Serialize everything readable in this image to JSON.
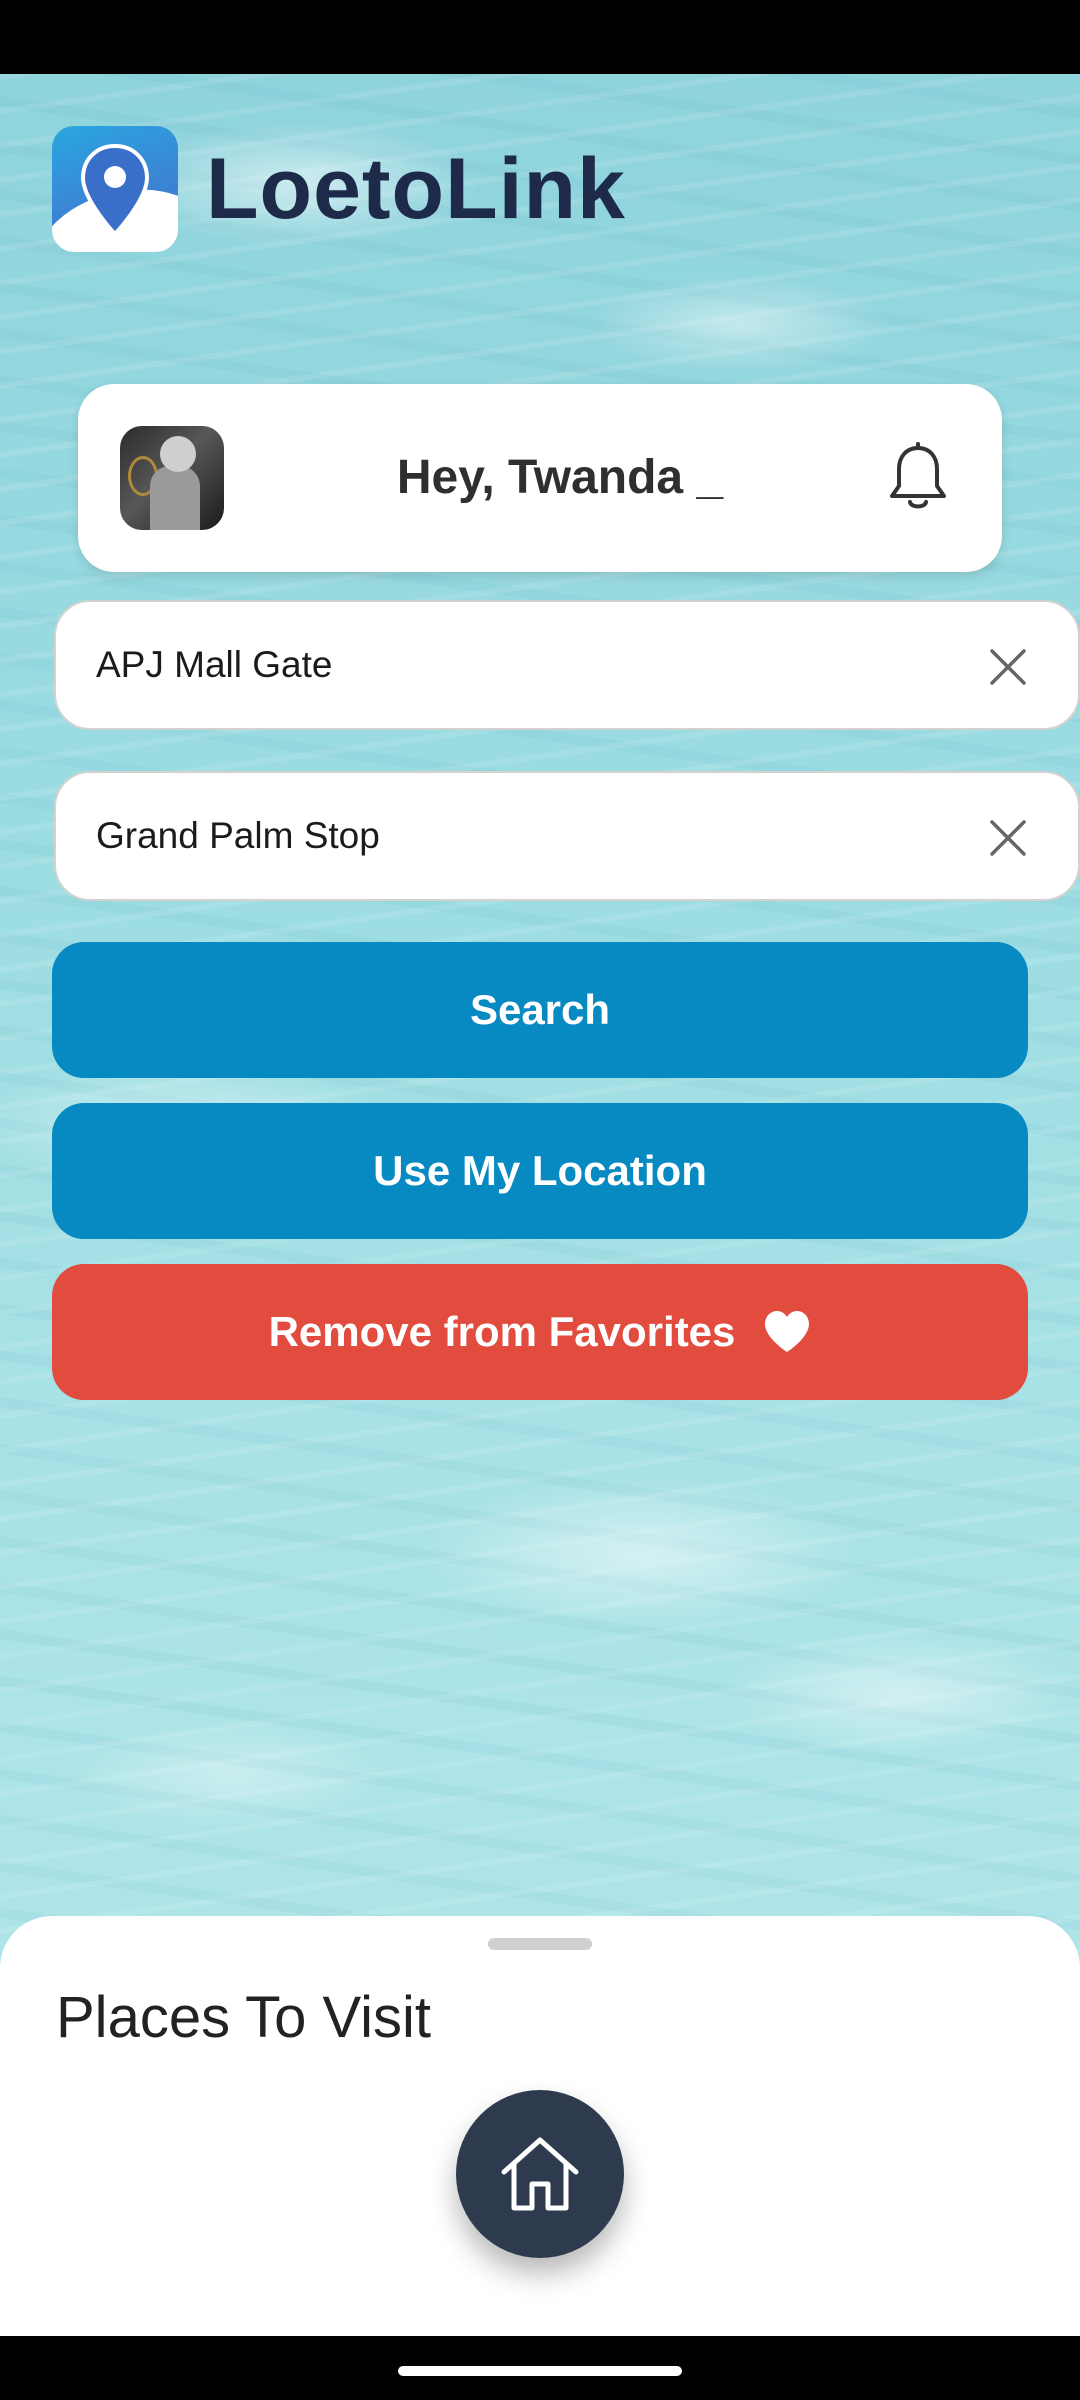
{
  "app": {
    "name": "LoetoLink"
  },
  "header": {
    "greeting": "Hey, Twanda _"
  },
  "search": {
    "from_value": "APJ Mall Gate",
    "to_value": "Grand Palm Stop"
  },
  "buttons": {
    "search_label": "Search",
    "location_label": "Use My Location",
    "favorites_label": "Remove from Favorites"
  },
  "sheet": {
    "title": "Places To Visit"
  },
  "icons": {
    "logo": "map-pin-icon",
    "notifications": "bell-icon",
    "clear": "close-icon",
    "favorite": "heart-icon",
    "home": "home-icon"
  },
  "colors": {
    "brand_text": "#1e2a4a",
    "primary_button": "#0789c1",
    "danger_button": "#e14c3f",
    "fab": "#2e3b4e"
  }
}
